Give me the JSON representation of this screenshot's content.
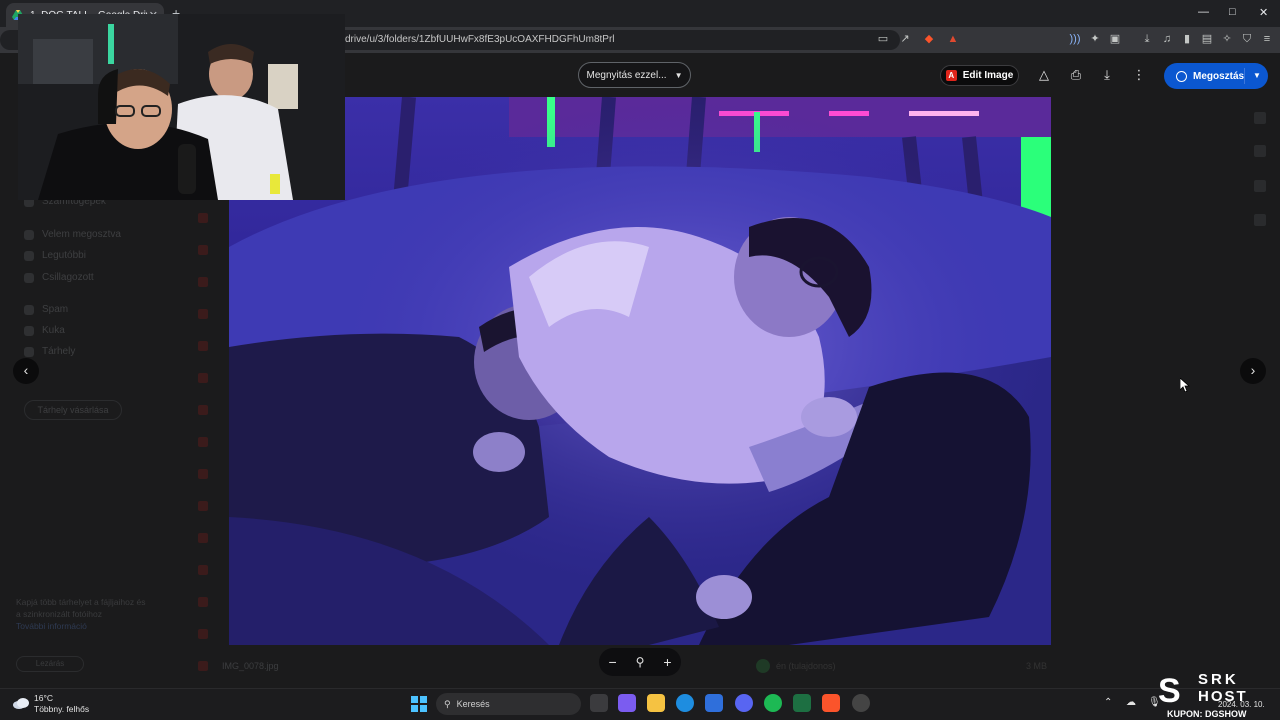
{
  "browser": {
    "tab_title": "1. DÓG TALI – Google Drive",
    "url": "drive/u/3/folders/1ZbfUUHwFx8fE3pUcOAXFHDGFhUm8tPrl"
  },
  "drive_background": {
    "sidebar_items": [
      "Számítógépek",
      "Velem megosztva",
      "Legutóbbi",
      "Csillagozott",
      "Spam",
      "Kuka",
      "Tárhely"
    ],
    "new_folder_label": "Tárhely vásárlása",
    "storage_note": "Kapjá több tárhelyet a fájljaihoz és a szinkronizált fotóihoz",
    "storage_link": "További információ",
    "storage_button": "Lezárás",
    "bottom_file_name": "IMG_0078.jpg",
    "bottom_owner": "én (tulajdonos)",
    "bottom_size": "3 MB"
  },
  "viewer": {
    "open_with_label": "Megnyitás ezzel...",
    "edit_image_label": "Edit Image",
    "share_label": "Megosztás",
    "prev_icon": "chevron-left-icon",
    "next_icon": "chevron-right-icon",
    "zoom_out": "−",
    "zoom_in": "+"
  },
  "taskbar": {
    "weather_temp": "16°C",
    "weather_desc": "Többny. felhős",
    "search_label": "Keresés",
    "date": "2024. 03. 10."
  },
  "watermark": {
    "brand_line1": "SRK",
    "brand_line2": "HOST",
    "coupon": "KUPON: DGSHOW"
  },
  "colors": {
    "share_blue": "#0b57d0",
    "adobe_red": "#e1251b",
    "photo_purple": "#4b3fd6"
  }
}
